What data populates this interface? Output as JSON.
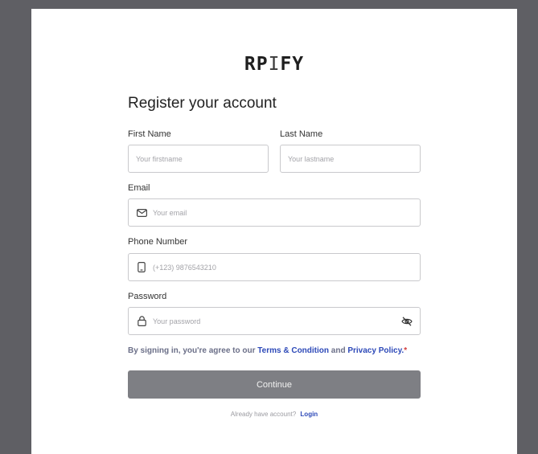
{
  "brand": {
    "logo_text": "RPIFY"
  },
  "form": {
    "title": "Register your account",
    "first_name": {
      "label": "First Name",
      "placeholder": "Your firstname"
    },
    "last_name": {
      "label": "Last Name",
      "placeholder": "Your lastname"
    },
    "email": {
      "label": "Email",
      "placeholder": "Your email"
    },
    "phone": {
      "label": "Phone Number",
      "placeholder": "(+123) 9876543210"
    },
    "password": {
      "label": "Password",
      "placeholder": "Your password"
    },
    "terms": {
      "prefix": "By signing in, you're agree to our",
      "terms_link": "Terms & Condition",
      "and": "and",
      "privacy_link": "Privacy Policy.",
      "required_mark": "*"
    },
    "continue_label": "Continue",
    "login_prompt": "Already have account?",
    "login_link": "Login"
  },
  "icons": {
    "email": "mail-icon",
    "phone": "phone-icon",
    "password": "lock-icon",
    "toggle": "eye-off-icon"
  },
  "colors": {
    "backdrop": "#5f5f64",
    "link": "#2d49b8",
    "button_bg": "#7e7f84",
    "required": "#d23b3b"
  }
}
